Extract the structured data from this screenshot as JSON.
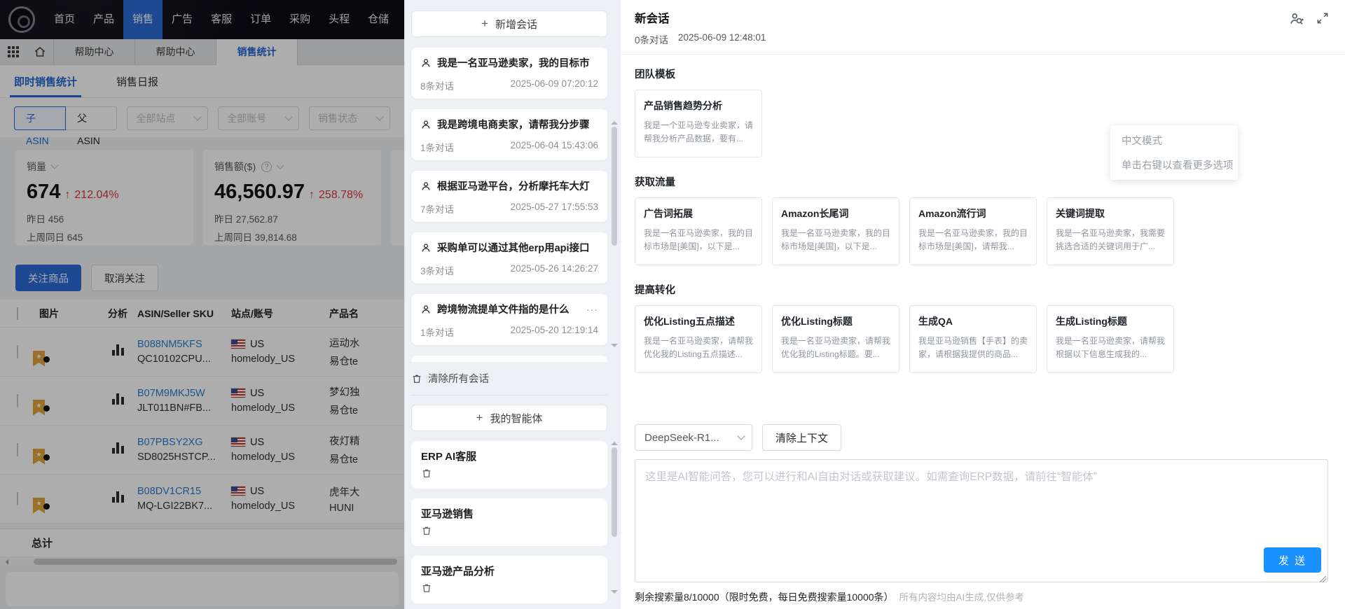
{
  "navbar": {
    "items": [
      "首页",
      "产品",
      "销售",
      "广告",
      "客服",
      "订单",
      "采购",
      "头程",
      "仓储"
    ]
  },
  "toolbar": {
    "tabs": [
      "帮助中心",
      "帮助中心",
      "销售统计"
    ]
  },
  "sales_panel": {
    "tabs": {
      "realtime": "即时销售统计",
      "daily": "销售日报"
    },
    "filters": {
      "asin_child": "子ASIN",
      "asin_parent": "父ASIN",
      "site_select": "全部站点",
      "account_select": "全部账号",
      "status_select": "销售状态"
    },
    "stats": [
      {
        "label": "销量",
        "value": "674",
        "delta": "212.04%",
        "yesterday": "昨日 456",
        "lastweek": "上周同日 645"
      },
      {
        "label": "销售额($)",
        "value": "46,560.97",
        "delta": "258.78%",
        "yesterday": "昨日 27,562.87",
        "lastweek": "上周同日 39,814.68"
      }
    ],
    "actions": {
      "follow": "关注商品",
      "unfollow": "取消关注"
    },
    "table": {
      "headers": [
        "图片",
        "分析",
        "ASIN/Seller SKU",
        "站点/账号",
        "产品名"
      ],
      "rows": [
        {
          "asin": "B088NM5KFS",
          "sku": "QC10102CPU...",
          "site": "US",
          "account": "homelody_US",
          "product": "运动水",
          "product2": "易仓te"
        },
        {
          "asin": "B07M9MKJ5W",
          "sku": "JLT011BN#FB...",
          "site": "US",
          "account": "homelody_US",
          "product": "梦幻独",
          "product2": "易仓te"
        },
        {
          "asin": "B07PBSY2XG",
          "sku": "SD8025HSTCP...",
          "site": "US",
          "account": "homelody_US",
          "product": "夜灯精",
          "product2": "易仓te"
        },
        {
          "asin": "B08DV1CR15",
          "sku": "MQ-LGI22BK7...",
          "site": "US",
          "account": "homelody_US",
          "product": "虎年大",
          "product2": "HUNI"
        }
      ],
      "total_label": "总计"
    }
  },
  "chat_sidebar": {
    "new_session_button": "新增会话",
    "conversations": [
      {
        "title": "我是一名亚马逊卖家，我的目标市",
        "count": "8条对话",
        "time": "2025-06-09 07:20:12"
      },
      {
        "title": "我是跨境电商卖家，请帮我分步骤",
        "count": "1条对话",
        "time": "2025-06-04 15:43:06"
      },
      {
        "title": "根据亚马逊平台，分析摩托车大灯",
        "count": "7条对话",
        "time": "2025-05-27 17:55:53"
      },
      {
        "title": "采购单可以通过其他erp用api接口",
        "count": "3条对话",
        "time": "2025-05-26 14:26:27"
      },
      {
        "title": "跨境物流提单文件指的是什么",
        "count": "1条对话",
        "time": "2025-05-20 12:19:14"
      }
    ],
    "clear_all": "清除所有会话",
    "my_agents_button": "我的智能体",
    "agents": [
      {
        "name": "ERP AI客服"
      },
      {
        "name": "亚马逊销售"
      },
      {
        "name": "亚马逊产品分析"
      }
    ]
  },
  "chat_main": {
    "title": "新会话",
    "count": "0条对话",
    "timestamp": "2025-06-09 12:48:01",
    "sections": [
      {
        "title": "团队模板",
        "cards": [
          {
            "title": "产品销售趋势分析",
            "desc": "我是一个亚马逊专业卖家，请帮我分析产品数据，要有..."
          }
        ]
      },
      {
        "title": "获取流量",
        "cards": [
          {
            "title": "广告词拓展",
            "desc": "我是一名亚马逊卖家，我的目标市场是[美国]，以下是..."
          },
          {
            "title": "Amazon长尾词",
            "desc": "我是一名亚马逊卖家，我的目标市场是[美国]，以下是..."
          },
          {
            "title": "Amazon流行词",
            "desc": "我是一名亚马逊卖家，我的目标市场是[美国]，请帮我..."
          },
          {
            "title": "关键词提取",
            "desc": "我是一名亚马逊卖家，我需要挑选合适的关键词用于广..."
          }
        ]
      },
      {
        "title": "提高转化",
        "cards": [
          {
            "title": "优化Listing五点描述",
            "desc": "我是一名亚马逊卖家，请帮我优化我的Listing五点描述..."
          },
          {
            "title": "优化Listing标题",
            "desc": "我是一名亚马逊卖家，请帮我优化我的Listing标题。要..."
          },
          {
            "title": "生成QA",
            "desc": "我是亚马逊销售【手表】的卖家，请根据我提供的商品..."
          },
          {
            "title": "生成Listing标题",
            "desc": "我是一名亚马逊卖家，请帮我根据以下信息生成我的..."
          }
        ]
      }
    ],
    "composer": {
      "model": "DeepSeek-R1...",
      "clear_context": "清除上下文",
      "placeholder": "这里是AI智能问答，您可以进行和AI自由对话或获取建议。如需查询ERP数据，请前往“智能体”",
      "send": "发 送",
      "menu_line1": "中文模式",
      "menu_line2": "单击右键以查看更多选项"
    },
    "footer": {
      "quota": "剩余搜索量8/10000（限时免费，每日免费搜索量10000条）",
      "disclaimer": "所有内容均由AI生成,仅供参考"
    }
  },
  "icons": {
    "plus": "+",
    "more": "···",
    "star": "★",
    "up_arrow": "↑",
    "help": "?"
  },
  "colors": {
    "accent": "#1890ff",
    "nav_active": "#2b6bd8",
    "link_blue": "#2d7dd2",
    "delta_red": "#d9363e"
  }
}
